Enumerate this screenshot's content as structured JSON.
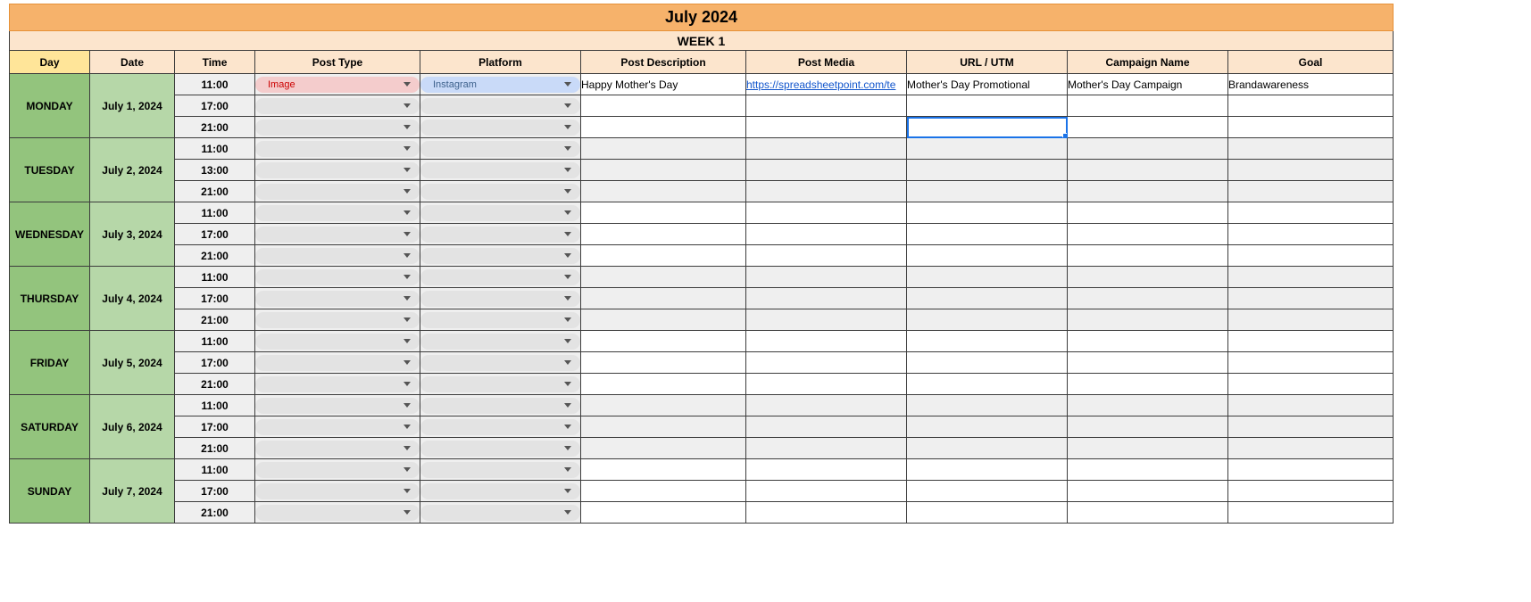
{
  "title": "July 2024",
  "week": "WEEK 1",
  "headers": {
    "day": "Day",
    "date": "Date",
    "time": "Time",
    "posttype": "Post Type",
    "platform": "Platform",
    "desc": "Post Description",
    "media": "Post Media",
    "url": "URL / UTM",
    "camp": "Campaign Name",
    "goal": "Goal"
  },
  "days": [
    {
      "name": "MONDAY",
      "date": "July 1, 2024",
      "shade": "white",
      "times": [
        "11:00",
        "17:00",
        "21:00"
      ]
    },
    {
      "name": "TUESDAY",
      "date": "July 2, 2024",
      "shade": "grey",
      "times": [
        "11:00",
        "13:00",
        "21:00"
      ]
    },
    {
      "name": "WEDNESDAY",
      "date": "July 3, 2024",
      "shade": "white",
      "times": [
        "11:00",
        "17:00",
        "21:00"
      ]
    },
    {
      "name": "THURSDAY",
      "date": "July 4, 2024",
      "shade": "grey",
      "times": [
        "11:00",
        "17:00",
        "21:00"
      ]
    },
    {
      "name": "FRIDAY",
      "date": "July 5, 2024",
      "shade": "white",
      "times": [
        "11:00",
        "17:00",
        "21:00"
      ]
    },
    {
      "name": "SATURDAY",
      "date": "July 6, 2024",
      "shade": "grey",
      "times": [
        "11:00",
        "17:00",
        "21:00"
      ]
    },
    {
      "name": "SUNDAY",
      "date": "July 7, 2024",
      "shade": "white",
      "times": [
        "11:00",
        "17:00",
        "21:00"
      ]
    }
  ],
  "row0": {
    "posttype": "Image",
    "platform": "Instagram",
    "desc": "Happy Mother's Day",
    "media": "https://spreadsheetpoint.com/te",
    "url": "Mother's Day Promotional",
    "camp": "Mother's Day Campaign",
    "goal": "Brandawareness"
  }
}
